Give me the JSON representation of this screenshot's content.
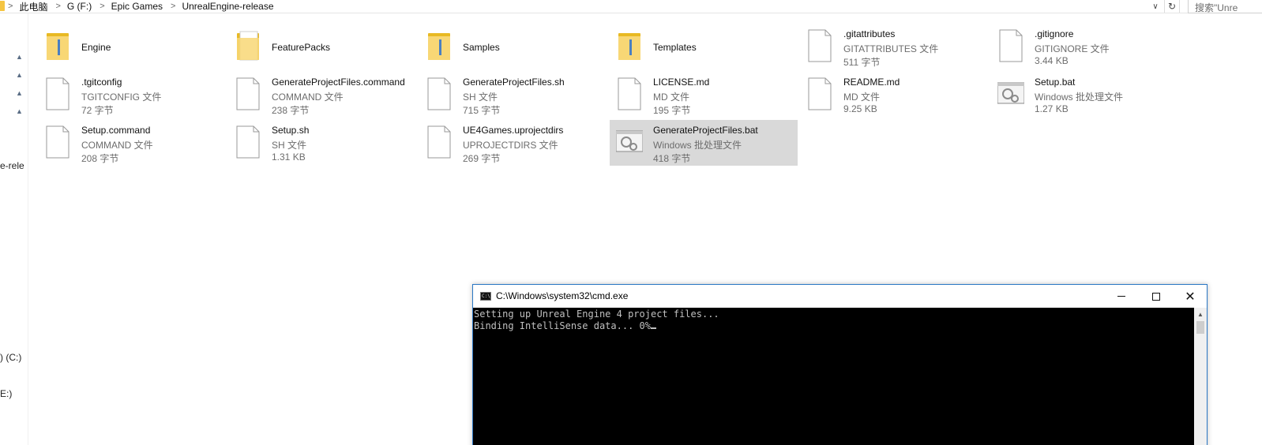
{
  "address_bar": {
    "breadcrumbs": [
      "此电脑",
      "G (F:)",
      "Epic Games",
      "UnrealEngine-release"
    ],
    "separator": ">",
    "search_placeholder": "搜索\"Unre"
  },
  "nav_pane": {
    "partial_labels": [
      "e-rele",
      ") (C:)",
      "E:)"
    ]
  },
  "files": [
    {
      "name": "Engine",
      "kind": "folder"
    },
    {
      "name": "FeaturePacks",
      "kind": "folder"
    },
    {
      "name": "Samples",
      "kind": "folder"
    },
    {
      "name": "Templates",
      "kind": "folder"
    },
    {
      "name": ".gitattributes",
      "type": "GITATTRIBUTES 文件",
      "size": "511 字节",
      "kind": "file"
    },
    {
      "name": ".gitignore",
      "type": "GITIGNORE 文件",
      "size": "3.44 KB",
      "kind": "file"
    },
    {
      "name": ".tgitconfig",
      "type": "TGITCONFIG 文件",
      "size": "72 字节",
      "kind": "file"
    },
    {
      "name": "GenerateProjectFiles.command",
      "type": "COMMAND 文件",
      "size": "238 字节",
      "kind": "file"
    },
    {
      "name": "GenerateProjectFiles.sh",
      "type": "SH 文件",
      "size": "715 字节",
      "kind": "file"
    },
    {
      "name": "LICENSE.md",
      "type": "MD 文件",
      "size": "195 字节",
      "kind": "file"
    },
    {
      "name": "README.md",
      "type": "MD 文件",
      "size": "9.25 KB",
      "kind": "file"
    },
    {
      "name": "Setup.bat",
      "type": "Windows 批处理文件",
      "size": "1.27 KB",
      "kind": "bat"
    },
    {
      "name": "Setup.command",
      "type": "COMMAND 文件",
      "size": "208 字节",
      "kind": "file"
    },
    {
      "name": "Setup.sh",
      "type": "SH 文件",
      "size": "1.31 KB",
      "kind": "file"
    },
    {
      "name": "UE4Games.uprojectdirs",
      "type": "UPROJECTDIRS 文件",
      "size": "269 字节",
      "kind": "file"
    },
    {
      "name": "GenerateProjectFiles.bat",
      "type": "Windows 批处理文件",
      "size": "418 字节",
      "kind": "bat",
      "selected": true
    }
  ],
  "cmd_window": {
    "title": "C:\\Windows\\system32\\cmd.exe",
    "icon_text": "C:\\",
    "lines": [
      "Setting up Unreal Engine 4 project files...",
      "Binding IntelliSense data... 0%"
    ]
  },
  "colors": {
    "folder": "#f5c542",
    "selection": "#d9d9d9",
    "cmd_border": "#2b78c5",
    "console_bg": "#000000",
    "console_text": "#c0c0c0"
  }
}
